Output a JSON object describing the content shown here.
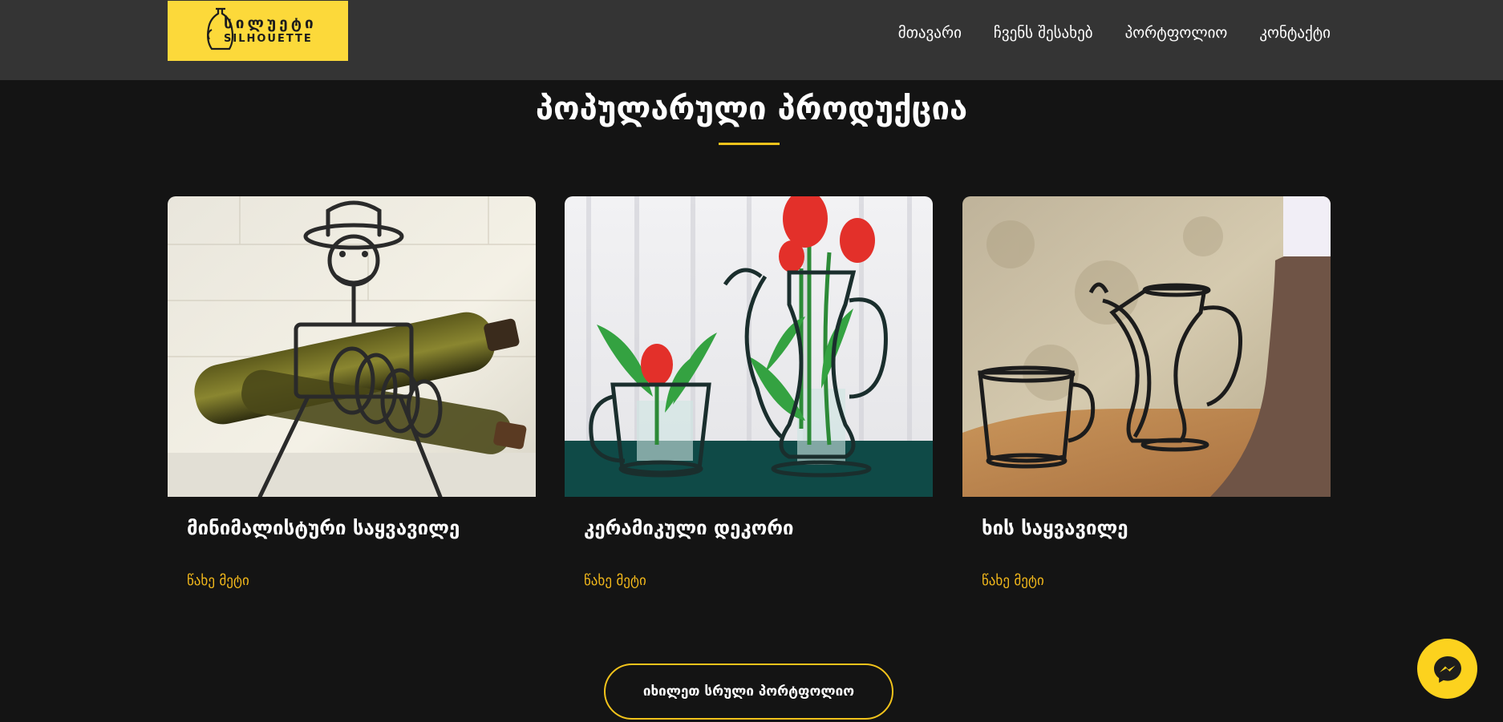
{
  "header": {
    "logo": {
      "text_geo": "სილუეტი",
      "text_latin": "SILHOUETTE"
    },
    "nav": [
      {
        "label": "მთავარი"
      },
      {
        "label": "ჩვენს შესახებ"
      },
      {
        "label": "პორტფოლიო"
      },
      {
        "label": "კონტაქტი"
      }
    ]
  },
  "section": {
    "title": "პოპულარული პროდუქცია"
  },
  "products": [
    {
      "title": "მინიმალისტური საყვავილე",
      "link": "წახე მეტი",
      "image_icon": "wine-holder-figure-photo"
    },
    {
      "title": "კერამიკული დეკორი",
      "link": "წახე მეტი",
      "image_icon": "tulip-vases-photo"
    },
    {
      "title": "ხის საყვავილე",
      "link": "წახე მეტი",
      "image_icon": "cup-and-teapot-silhouette-photo"
    }
  ],
  "cta": {
    "label": "იხილეთ სრული პორტფოლიო"
  },
  "colors": {
    "accent": "#f2c31b",
    "logo_bg": "#fcd93a",
    "header_bg": "#343434",
    "page_bg": "#141414",
    "link": "#f2b81b"
  },
  "icons": {
    "messenger": "messenger-icon"
  }
}
